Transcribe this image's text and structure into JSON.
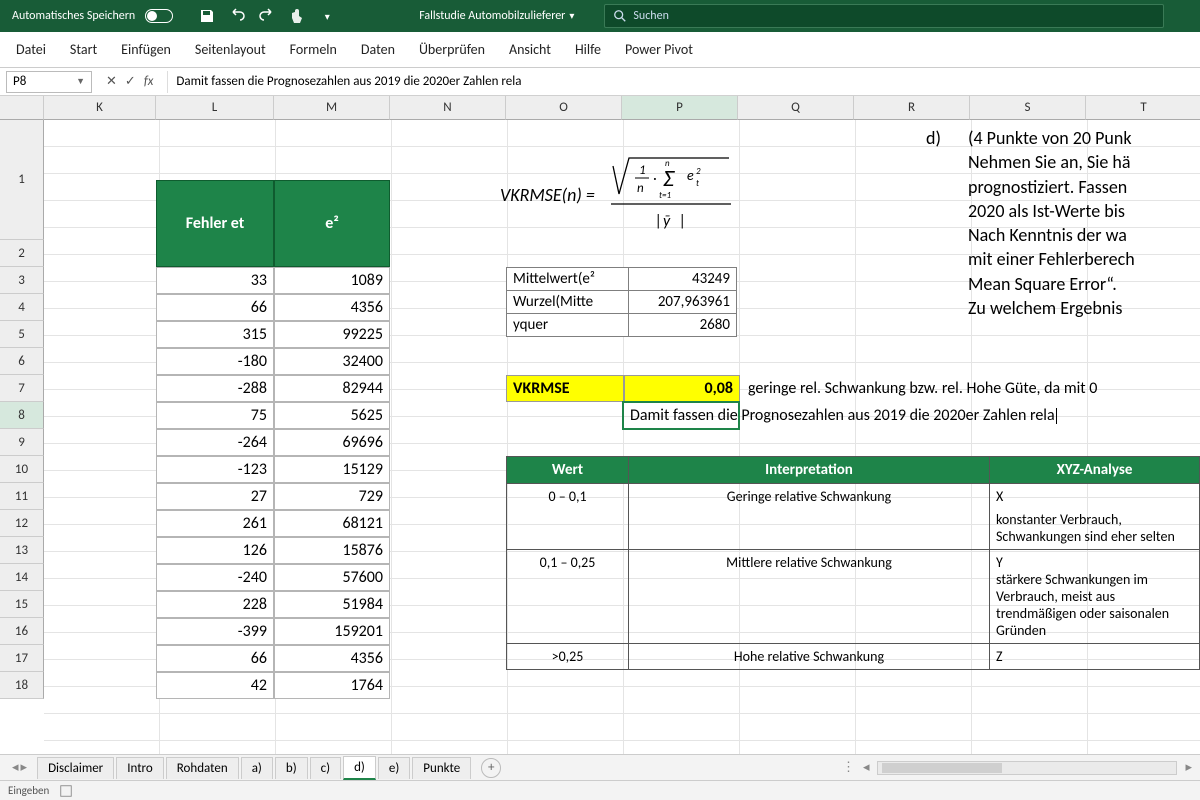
{
  "titlebar": {
    "autosave_label": "Automatisches Speichern",
    "file_name": "Fallstudie Automobilzulieferer",
    "search_placeholder": "Suchen"
  },
  "ribbon": [
    "Datei",
    "Start",
    "Einfügen",
    "Seitenlayout",
    "Formeln",
    "Daten",
    "Überprüfen",
    "Ansicht",
    "Hilfe",
    "Power Pivot"
  ],
  "namebox": "P8",
  "formula": "Damit fassen die Prognosezahlen aus 2019 die 2020er Zahlen rela",
  "columns": [
    "K",
    "L",
    "M",
    "N",
    "O",
    "P",
    "Q",
    "R",
    "S",
    "T"
  ],
  "rows": [
    "1",
    "2",
    "3",
    "4",
    "5",
    "6",
    "7",
    "8",
    "9",
    "10",
    "11",
    "12",
    "13",
    "14",
    "15",
    "16",
    "17",
    "18"
  ],
  "active_column": "P",
  "active_row": "8",
  "headers": {
    "L": "Fehler et",
    "M": "e²"
  },
  "data_rows": [
    {
      "r": "3",
      "L": "33",
      "M": "1089"
    },
    {
      "r": "4",
      "L": "66",
      "M": "4356"
    },
    {
      "r": "5",
      "L": "315",
      "M": "99225"
    },
    {
      "r": "6",
      "L": "-180",
      "M": "32400"
    },
    {
      "r": "7",
      "L": "-288",
      "M": "82944"
    },
    {
      "r": "8",
      "L": "75",
      "M": "5625"
    },
    {
      "r": "9",
      "L": "-264",
      "M": "69696"
    },
    {
      "r": "10",
      "L": "-123",
      "M": "15129"
    },
    {
      "r": "11",
      "L": "27",
      "M": "729"
    },
    {
      "r": "12",
      "L": "261",
      "M": "68121"
    },
    {
      "r": "13",
      "L": "126",
      "M": "15876"
    },
    {
      "r": "14",
      "L": "-240",
      "M": "57600"
    },
    {
      "r": "15",
      "L": "228",
      "M": "51984"
    },
    {
      "r": "16",
      "L": "-399",
      "M": "159201"
    },
    {
      "r": "17",
      "L": "66",
      "M": "4356"
    },
    {
      "r": "18",
      "L": "42",
      "M": "1764"
    }
  ],
  "calc": {
    "mean_label": "Mittelwert(e²",
    "mean_val": "43249",
    "sqrt_label": "Wurzel(Mitte",
    "sqrt_val": "207,963961",
    "ybar_label": "yquer",
    "ybar_val": "2680",
    "vkrmse_label": "VKRMSE",
    "vkrmse_val": "0,08",
    "comment7": "geringe rel. Schwankung bzw. rel. Hohe Güte, da mit 0",
    "comment8": "Damit fassen die Prognosezahlen aus 2019 die 2020er Zahlen rela"
  },
  "formula_label": "VKRMSE(n) =",
  "task": {
    "bullet": "d)",
    "lines": [
      "(4 Punkte von 20 Punk",
      "Nehmen Sie an, Sie hä",
      "prognostiziert. Fassen",
      "2020 als Ist-Werte bis",
      "Nach Kenntnis der wa",
      "mit einer Fehlerberech",
      "Mean Square Error“.",
      "Zu welchem Ergebnis"
    ]
  },
  "interp": {
    "headers": [
      "Wert",
      "Interpretation",
      "XYZ-Analyse"
    ],
    "rows": [
      {
        "wert": "0 – 0,1",
        "interp": "Geringe relative Schwankung",
        "xyz": "X",
        "xyz2": "konstanter Verbrauch, Schwankungen sind eher selten"
      },
      {
        "wert": "0,1 – 0,25",
        "interp": "Mittlere relative Schwankung",
        "xyz": "Y",
        "xyz2": "stärkere Schwankungen im Verbrauch, meist aus trendmäßigen oder saisonalen Gründen"
      },
      {
        "wert": ">0,25",
        "interp": "Hohe relative Schwankung",
        "xyz": "Z",
        "xyz2": ""
      }
    ]
  },
  "sheet_tabs": [
    "Disclaimer",
    "Intro",
    "Rohdaten",
    "a)",
    "b)",
    "c)",
    "d)",
    "e)",
    "Punkte"
  ],
  "active_tab": "d)",
  "status": "Eingeben"
}
